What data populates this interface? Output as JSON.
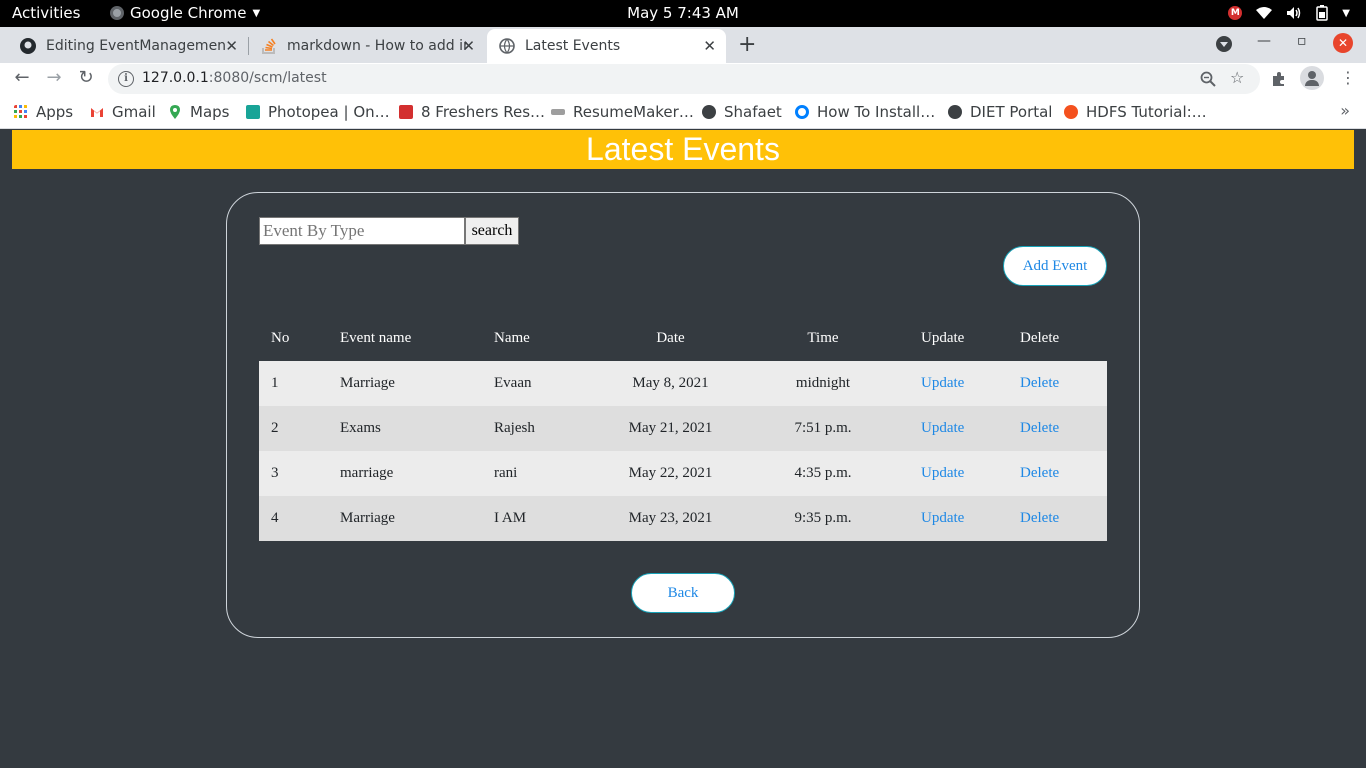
{
  "system": {
    "activities": "Activities",
    "app_name": "Google Chrome",
    "clock": "May 5   7:43 AM",
    "tray_badge": "M"
  },
  "browser": {
    "tabs": [
      {
        "title": "Editing EventManagemen",
        "icon": "github-icon"
      },
      {
        "title": "markdown - How to add im",
        "icon": "stackoverflow-icon"
      },
      {
        "title": "Latest Events",
        "icon": "globe-icon"
      }
    ],
    "url_host": "127.0.0.1",
    "url_path": ":8080/scm/latest",
    "bookmarks": [
      {
        "label": "Apps",
        "icon": "apps-grid-icon"
      },
      {
        "label": "Gmail",
        "icon": "gmail-icon"
      },
      {
        "label": "Maps",
        "icon": "maps-icon"
      },
      {
        "label": "Photopea | On…",
        "icon": "photopea-icon"
      },
      {
        "label": "8 Freshers Res…",
        "icon": "freshers-icon"
      },
      {
        "label": "ResumeMaker…",
        "icon": "resumemaker-icon"
      },
      {
        "label": "Shafaet",
        "icon": "globe-icon"
      },
      {
        "label": "How To Install…",
        "icon": "install-icon"
      },
      {
        "label": "DIET Portal",
        "icon": "globe-icon"
      },
      {
        "label": "HDFS Tutorial:…",
        "icon": "hdfs-icon"
      }
    ]
  },
  "page": {
    "title": "Latest Events",
    "search_placeholder": "Event By Type",
    "search_label": "search",
    "add_label": "Add Event",
    "back_label": "Back",
    "columns": [
      "No",
      "Event name",
      "Name",
      "Date",
      "Time",
      "Update",
      "Delete"
    ],
    "rows": [
      {
        "no": "1",
        "event": "Marriage",
        "name": "Evaan",
        "date": "May 8, 2021",
        "time": "midnight",
        "update": "Update",
        "delete": "Delete"
      },
      {
        "no": "2",
        "event": "Exams",
        "name": "Rajesh",
        "date": "May 21, 2021",
        "time": "7:51 p.m.",
        "update": "Update",
        "delete": "Delete"
      },
      {
        "no": "3",
        "event": "marriage",
        "name": "rani",
        "date": "May 22, 2021",
        "time": "4:35 p.m.",
        "update": "Update",
        "delete": "Delete"
      },
      {
        "no": "4",
        "event": "Marriage",
        "name": "I AM",
        "date": "May 23, 2021",
        "time": "9:35 p.m.",
        "update": "Update",
        "delete": "Delete"
      }
    ]
  },
  "colors": {
    "banner": "#ffc107",
    "background": "#343a40",
    "link": "#1e88e5"
  }
}
